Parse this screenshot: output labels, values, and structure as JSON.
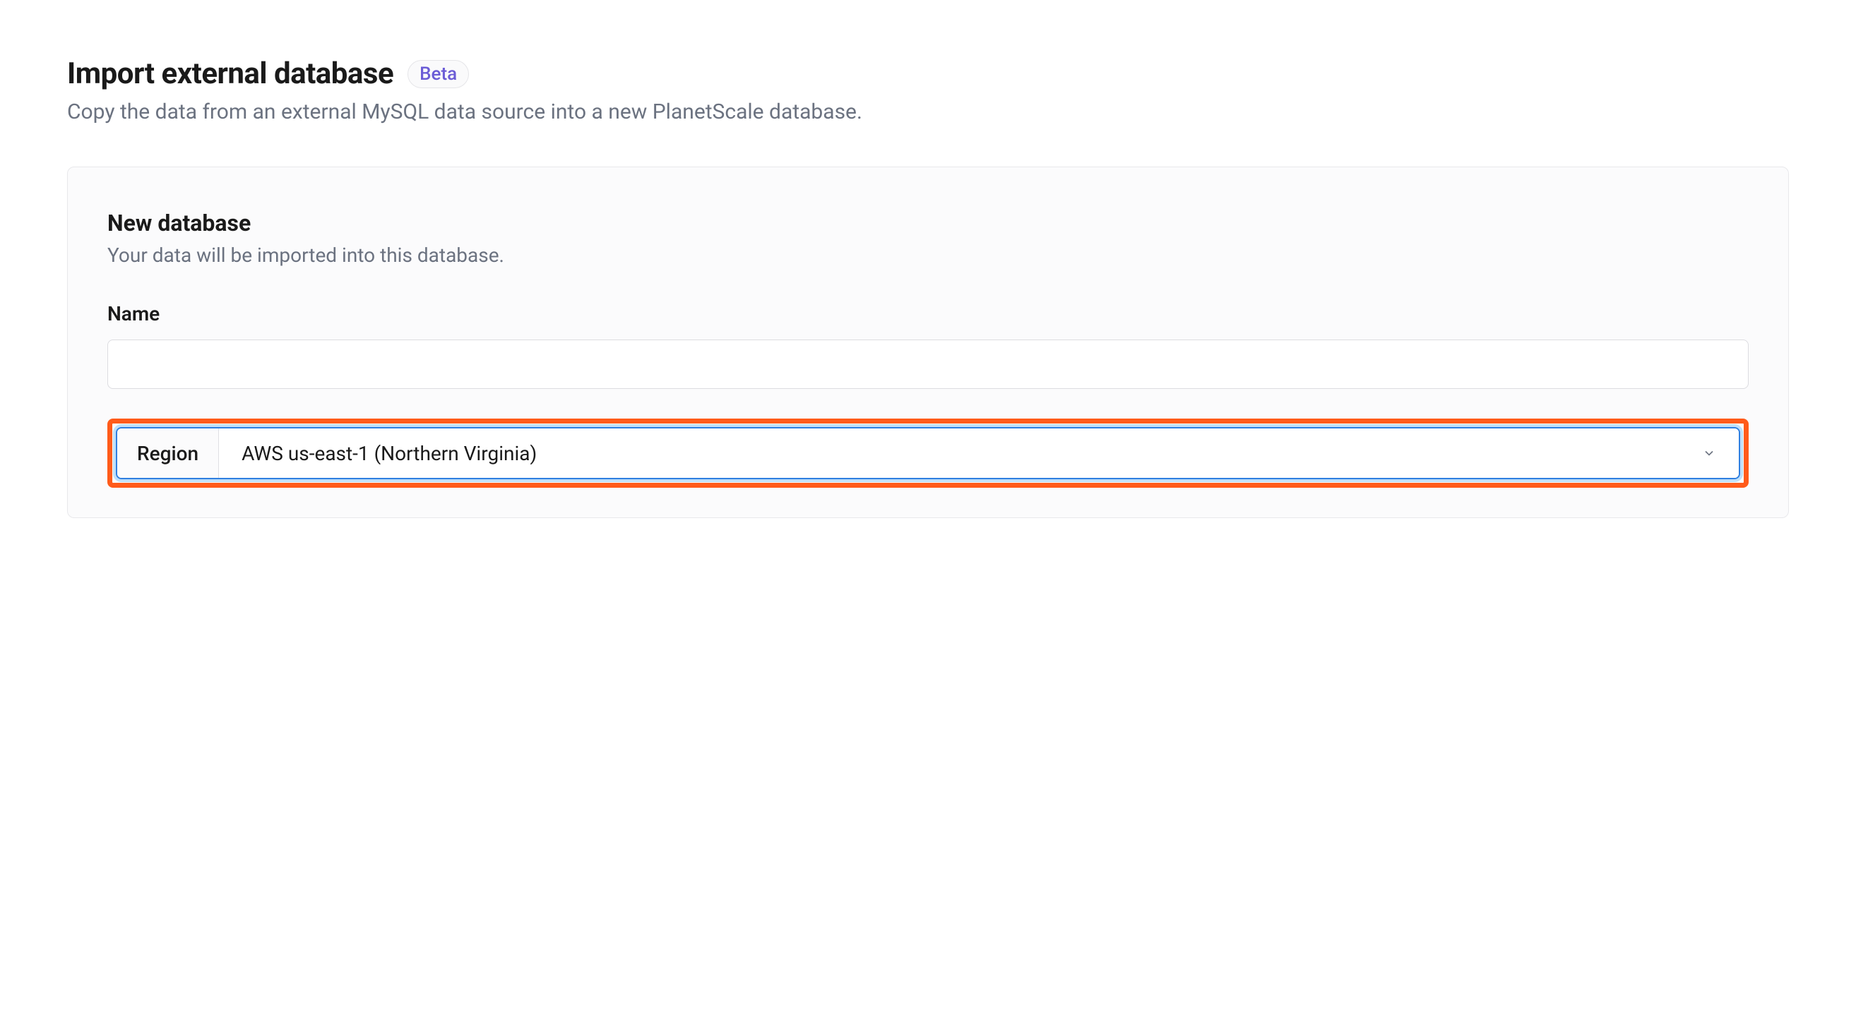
{
  "header": {
    "title": "Import external database",
    "badge": "Beta",
    "subtitle": "Copy the data from an external MySQL data source into a new PlanetScale database."
  },
  "card": {
    "section_title": "New database",
    "section_subtitle": "Your data will be imported into this database.",
    "name_label": "Name",
    "name_value": "",
    "region_label": "Region",
    "region_value": "AWS us-east-1 (Northern Virginia)"
  }
}
